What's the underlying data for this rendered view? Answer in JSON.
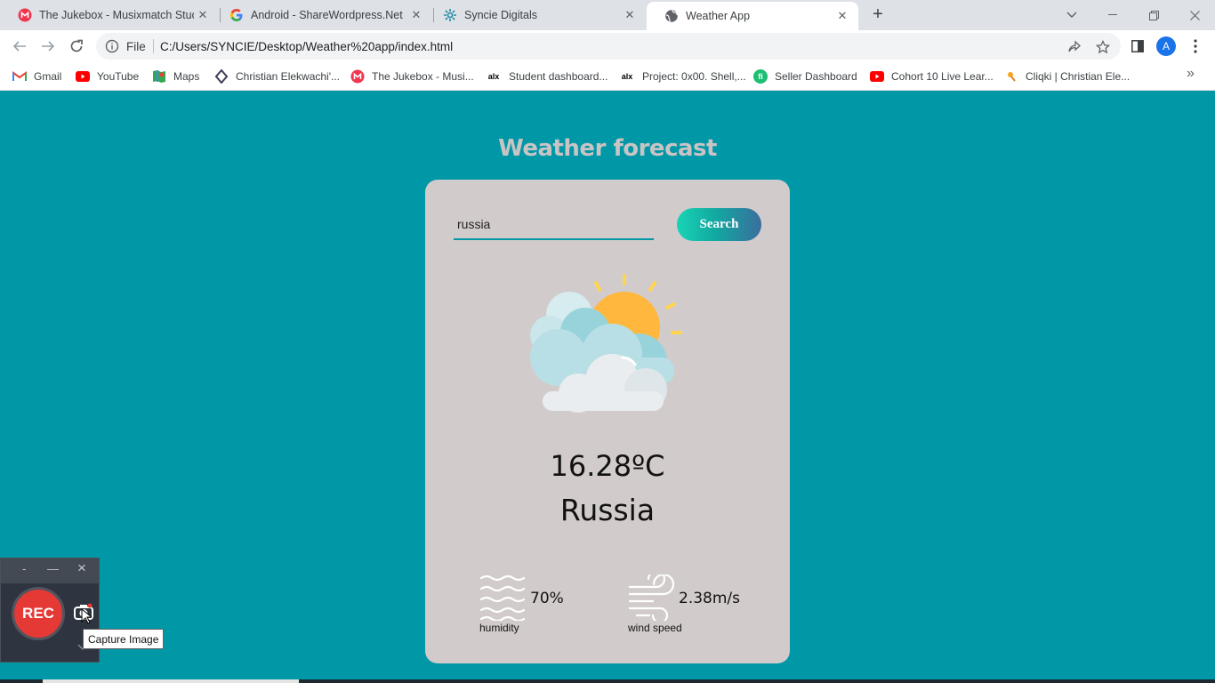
{
  "browser": {
    "tabs": [
      {
        "title": "The Jukebox - Musixmatch Studio",
        "icon": "musixmatch-icon",
        "active": false
      },
      {
        "title": "Android - ShareWordpress.Net",
        "icon": "google-g-icon",
        "active": false
      },
      {
        "title": "Syncie Digitals",
        "icon": "syncie-icon",
        "active": false
      },
      {
        "title": "Weather App",
        "icon": "globe-icon",
        "active": true
      }
    ],
    "address": {
      "scheme_label": "File",
      "url": "C:/Users/SYNCIE/Desktop/Weather%20app/index.html"
    },
    "avatar_letter": "A",
    "bookmarks": [
      {
        "label": "Gmail",
        "icon": "gmail-icon"
      },
      {
        "label": "YouTube",
        "icon": "youtube-icon"
      },
      {
        "label": "Maps",
        "icon": "maps-icon"
      },
      {
        "label": "Christian Elekwachi'...",
        "icon": "bookmark-site-icon"
      },
      {
        "label": "The Jukebox - Musi...",
        "icon": "musixmatch-icon"
      },
      {
        "label": "Student dashboard...",
        "icon": "alx-icon"
      },
      {
        "label": "Project: 0x00. Shell,...",
        "icon": "alx-icon"
      },
      {
        "label": "Seller Dashboard",
        "icon": "fiverr-icon"
      },
      {
        "label": "Cohort 10 Live Lear...",
        "icon": "youtube-icon"
      },
      {
        "label": "Cliqki | Christian Ele...",
        "icon": "cliqki-icon"
      }
    ],
    "bookmark_icon_texts": {
      "alx": "alx",
      "fiverr": "fi"
    }
  },
  "page": {
    "title": "Weather forecast",
    "search": {
      "value": "russia",
      "button_label": "Search"
    },
    "weather": {
      "icon": "partly-cloudy-sun-icon",
      "temperature": "16.28ºC",
      "city": "Russia"
    },
    "humidity": {
      "value": "70%",
      "label": "humidity",
      "icon": "humidity-waves-icon"
    },
    "wind": {
      "value": "2.38m/s",
      "label": "wind speed",
      "icon": "wind-icon"
    }
  },
  "recorder": {
    "rec_label": "REC",
    "minimize_glyph": "—",
    "close_glyph": "×",
    "capture_tooltip": "Capture Image"
  },
  "colors": {
    "page_background": "#0097a7",
    "card_background": "#d2cbcb",
    "title_color": "#c9c4c4",
    "rec_red": "#e53935"
  }
}
